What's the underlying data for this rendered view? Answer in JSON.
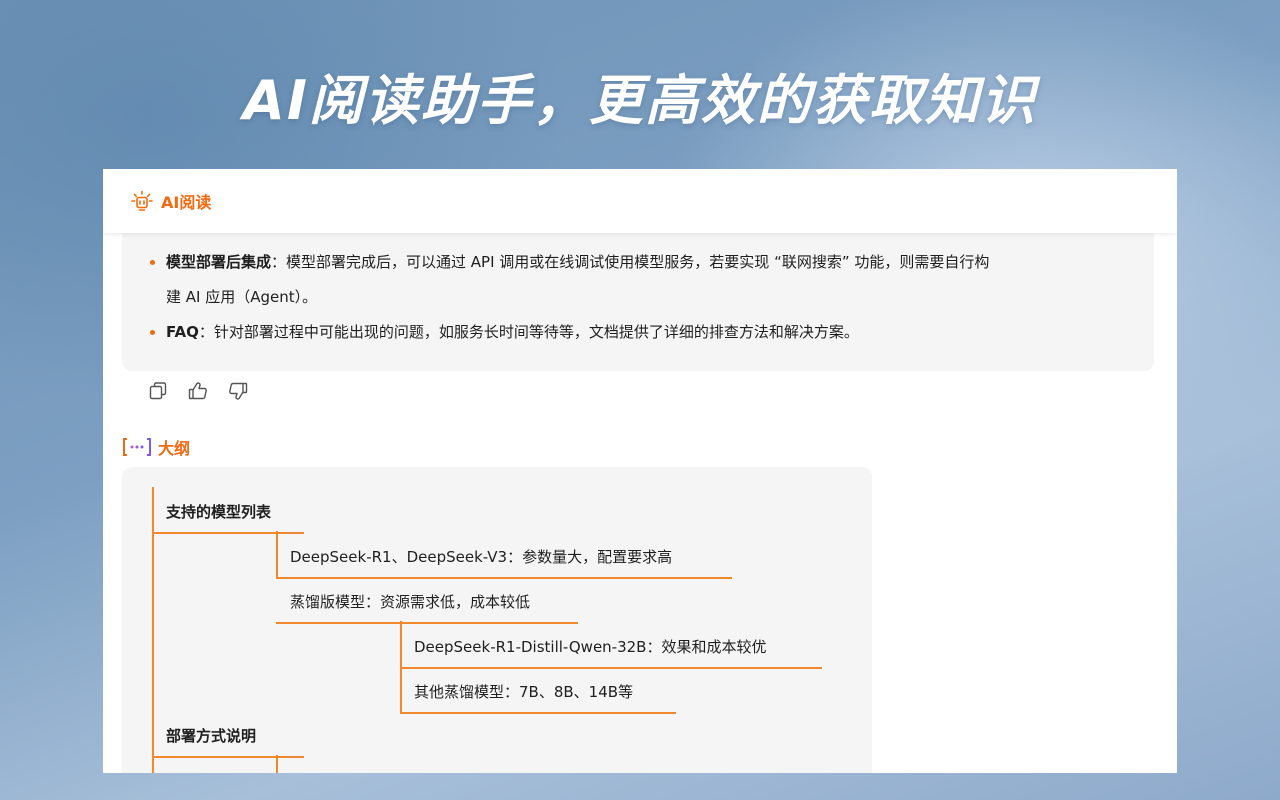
{
  "headline": "AI阅读助手，更高效的获取知识",
  "panel": {
    "header_title": "AI阅读",
    "summary": [
      {
        "bold": "模型部署后集成",
        "sep": "：",
        "text": "模型部署完成后，可以通过 API 调用或在线调试使用模型服务，若要实现 “联网搜索” 功能，则需要自行构",
        "text2": "建 AI 应用（Agent）。"
      },
      {
        "bold": "FAQ",
        "sep": "：",
        "text": "针对部署过程中可能出现的问题，如服务长时间等待等，文档提供了详细的排查方法和解决方案。"
      }
    ],
    "actions": [
      {
        "icon": "copy-icon"
      },
      {
        "icon": "thumbs-up-icon"
      },
      {
        "icon": "thumbs-down-icon"
      }
    ],
    "outline": {
      "title": "大纲",
      "nodes": [
        {
          "label": "支持的模型列表",
          "level": 1
        },
        {
          "label": "DeepSeek-R1、DeepSeek-V3：参数量大，配置要求高",
          "level": 2
        },
        {
          "label": "蒸馏版模型：资源需求低，成本较低",
          "level": 2
        },
        {
          "label": "DeepSeek-R1-Distill-Qwen-32B：效果和成本较优",
          "level": 3
        },
        {
          "label": "其他蒸馏模型：7B、8B、14B等",
          "level": 3
        },
        {
          "label": "部署方式说明",
          "level": 1
        }
      ]
    }
  },
  "colors": {
    "accent": "#f26a10",
    "branch": "#f0892e",
    "card": "#f5f5f5",
    "text": "#1f1f1f"
  }
}
